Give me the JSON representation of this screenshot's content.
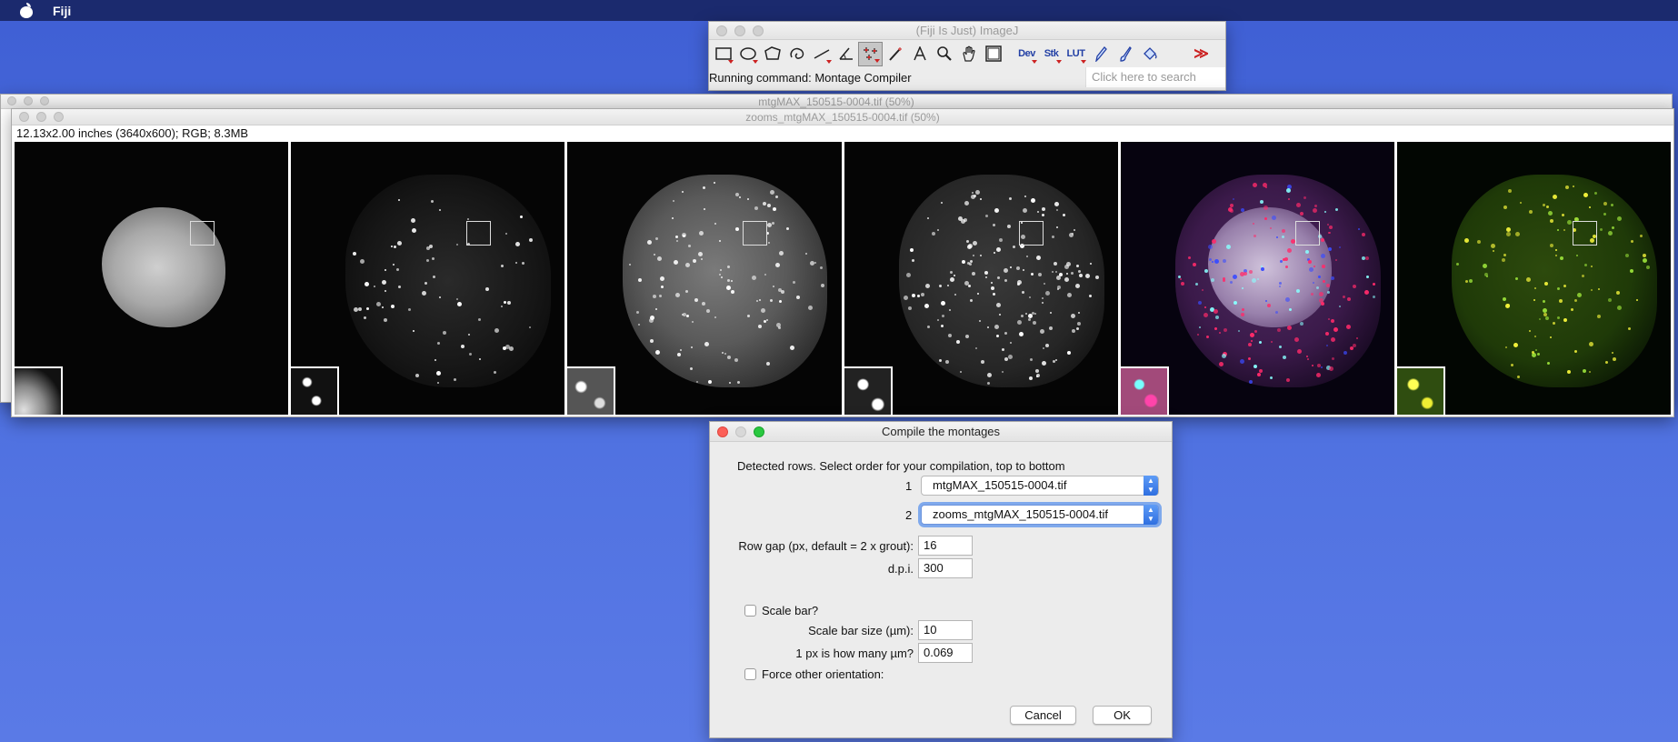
{
  "menubar": {
    "app_name": "Fiji"
  },
  "imagej": {
    "title": "(Fiji Is Just) ImageJ",
    "status": "Running command: Montage Compiler",
    "search_placeholder": "Click here to search",
    "tool_text": {
      "dev": "Dev",
      "stk": "Stk",
      "lut": "LUT",
      "more": "≫"
    }
  },
  "image_window_1": {
    "title": "mtgMAX_150515-0004.tif (50%)"
  },
  "image_window_2": {
    "title": "zooms_mtgMAX_150515-0004.tif (50%)",
    "info": "12.13x2.00 inches (3640x600); RGB; 8.3MB"
  },
  "dialog": {
    "title": "Compile the montages",
    "intro": "Detected rows. Select order for your compilation, top to bottom",
    "rows": [
      {
        "index": "1",
        "value": "mtgMAX_150515-0004.tif"
      },
      {
        "index": "2",
        "value": "zooms_mtgMAX_150515-0004.tif"
      }
    ],
    "row_gap_label": "Row gap (px, default = 2 x grout):",
    "row_gap_value": "16",
    "dpi_label": "d.p.i.",
    "dpi_value": "300",
    "scale_bar_label": "Scale bar?",
    "scale_bar_size_label": "Scale bar size (µm):",
    "scale_bar_size_value": "10",
    "px_um_label": "1 px is how many µm?",
    "px_um_value": "0.069",
    "force_orientation_label": "Force other orientation:",
    "cancel_label": "Cancel",
    "ok_label": "OK"
  }
}
